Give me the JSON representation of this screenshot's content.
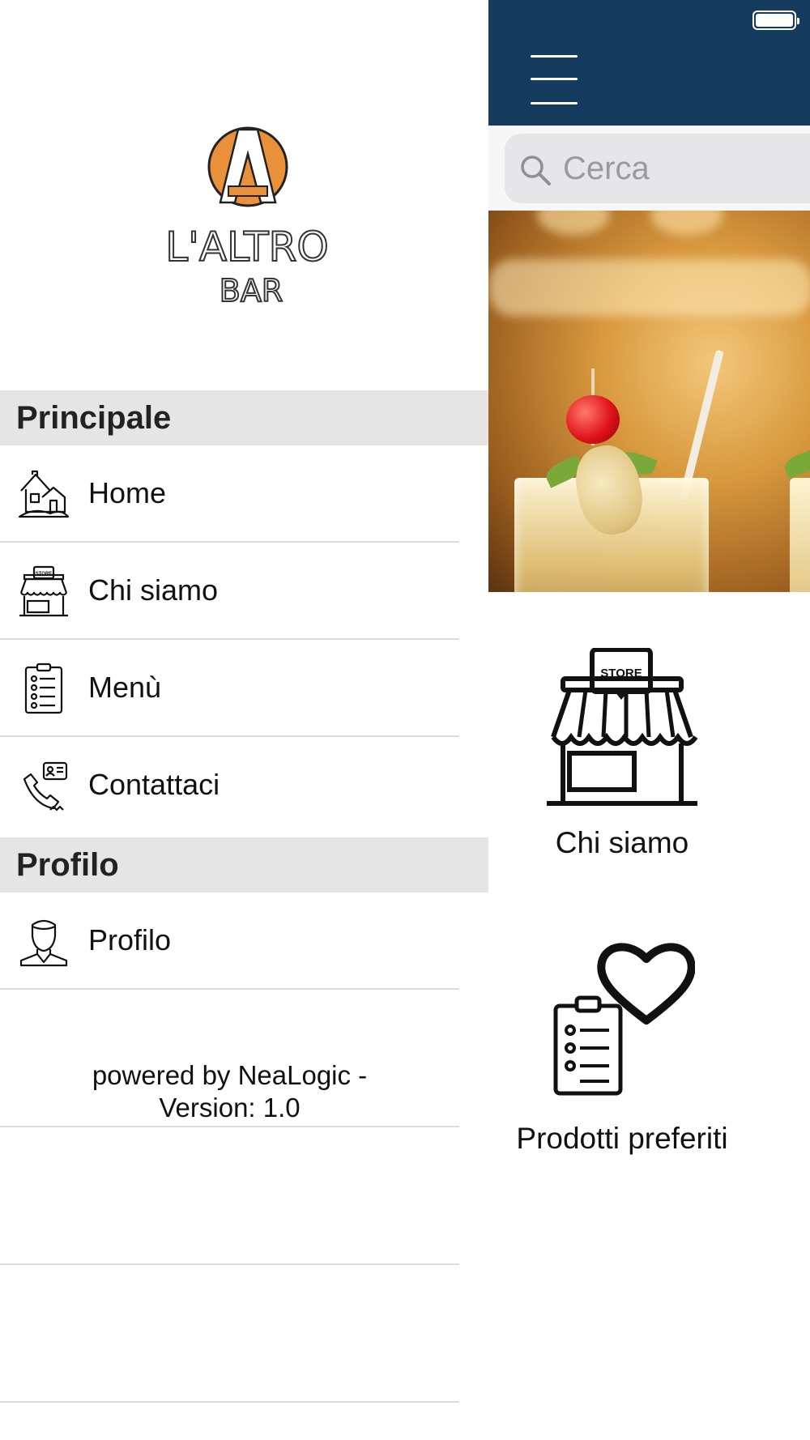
{
  "app": {
    "search": {
      "placeholder": "Cerca"
    },
    "tiles": [
      {
        "label": "Chi siamo",
        "icon": "store-icon"
      },
      {
        "label": "Prodotti preferiti",
        "icon": "favorite-products-icon"
      }
    ],
    "colors": {
      "topbar": "#153b5f",
      "logo_accent": "#e8913a"
    }
  },
  "drawer": {
    "logo": {
      "line1": "L'ALTRO",
      "line2": "BAR",
      "letter": "A"
    },
    "sections": [
      {
        "title": "Principale",
        "items": [
          {
            "label": "Home",
            "icon": "house-icon"
          },
          {
            "label": "Chi siamo",
            "icon": "store-icon"
          },
          {
            "label": "Menù",
            "icon": "clipboard-list-icon"
          },
          {
            "label": "Contattaci",
            "icon": "phone-contact-icon"
          }
        ]
      },
      {
        "title": "Profilo",
        "items": [
          {
            "label": "Profilo",
            "icon": "user-icon"
          }
        ]
      }
    ],
    "footer": {
      "line1": "powered by NeaLogic -",
      "line2": "Version: 1.0"
    }
  }
}
